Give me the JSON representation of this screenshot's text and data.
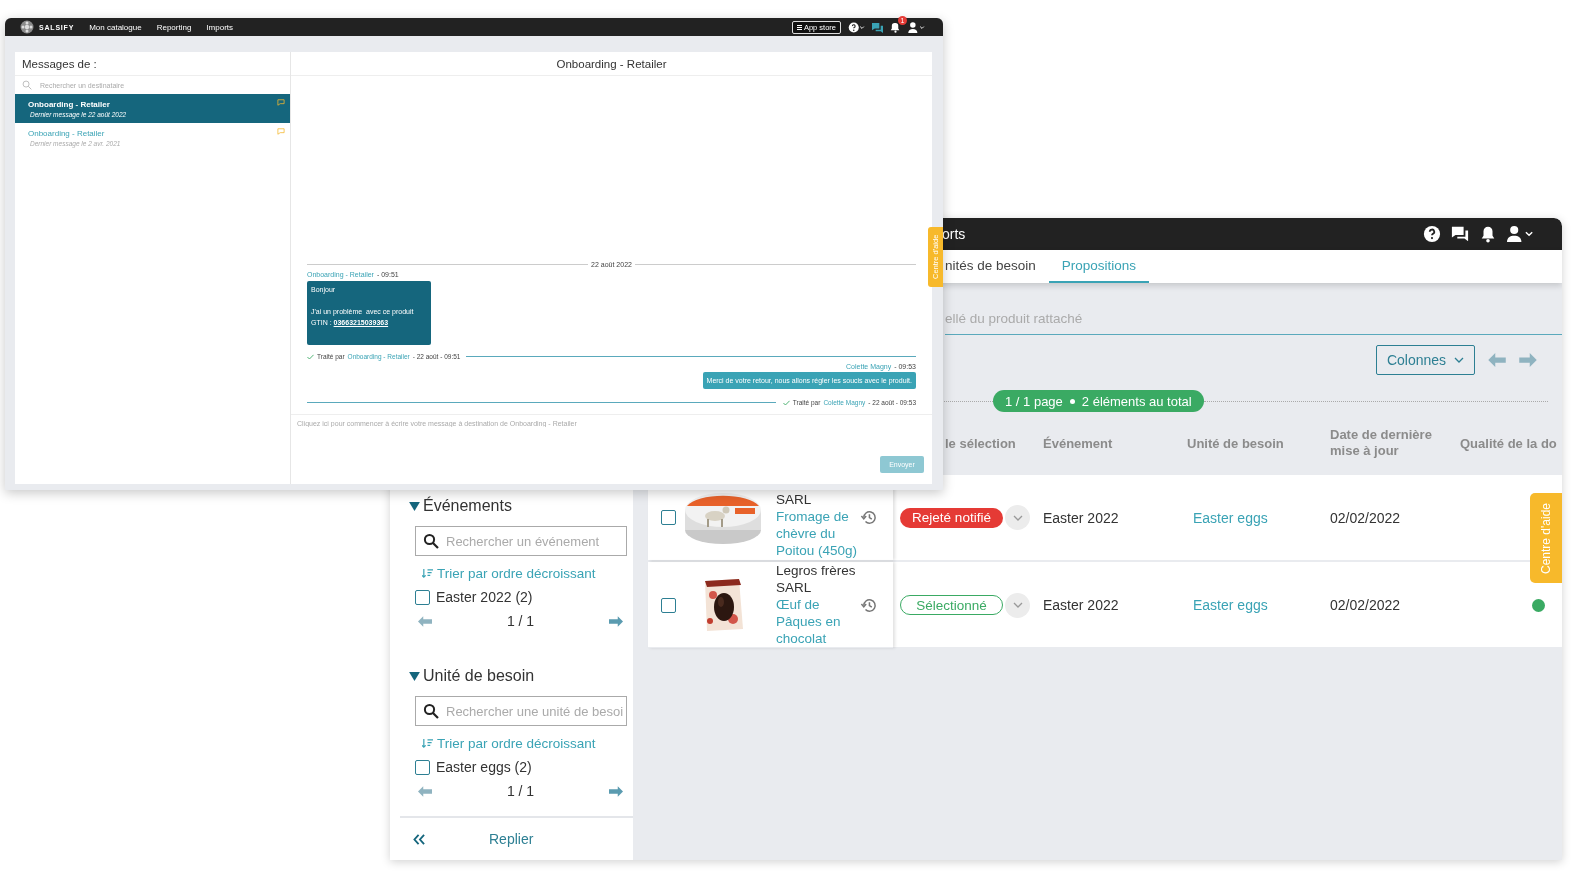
{
  "messaging_window": {
    "nav": {
      "logo": "SALSIFY",
      "items": [
        "Mon catalogue",
        "Reporting",
        "Imports"
      ],
      "app_store": "App store",
      "notification_count": "1"
    },
    "title": "Messages de :",
    "search": {
      "placeholder": "Rechercher un destinataire"
    },
    "conversations": [
      {
        "name": "Onboarding - Retailer",
        "last_message": "Dernier message le 22 août 2022",
        "selected": true
      },
      {
        "name": "Onboarding - Retailer",
        "last_message": "Dernier message le 2 avr. 2021",
        "selected": false
      }
    ],
    "thread_title": "Onboarding - Retailer",
    "date_separator": "22 août 2022",
    "messages": [
      {
        "kind": "incoming",
        "sender": "Onboarding - Retailer",
        "time": "- 09:51",
        "paragraphs": [
          "Bonjour",
          "J'ai un problème  avec ce produit"
        ],
        "gtin_label": "GTIN :",
        "gtin": "03663215039363",
        "processed": {
          "label": "Traité par",
          "by": "Onboarding - Retailer",
          "when": "- 22 août - 09:51"
        }
      },
      {
        "kind": "outgoing",
        "sender": "Colette Magny",
        "time": "- 09:53",
        "paragraphs": [
          "Merci de votre retour, nous allons régler les soucis avec le produit."
        ],
        "processed": {
          "label": "Traité par",
          "by": "Colette Magny",
          "when": "- 22 août - 09:53"
        }
      }
    ],
    "composer": {
      "placeholder": "Cliquez ici pour commencer à écrire votre message à destination de Onboarding - Retailer"
    },
    "send_button": "Envoyer",
    "help_tab": "Centre d'aide"
  },
  "catalog_window": {
    "nav_title": "orts",
    "tabs": [
      {
        "label": "nités de besoin",
        "selected": false
      },
      {
        "label": "Propositions",
        "selected": true
      }
    ],
    "search": {
      "placeholder": "ellé du produit rattaché"
    },
    "columns_button": "Colonnes",
    "pagination": {
      "page": "1 / 1 page",
      "total": "2 éléments au total"
    },
    "columns": [
      "le sélection",
      "Événement",
      "Unité de besoin",
      "Date de dernière mise à jour",
      "Qualité de la do"
    ],
    "rows": [
      {
        "checked": false,
        "supplier": "SARL",
        "product": "Fromage de chèvre du Poitou (450g)",
        "status": "Rejeté notifié",
        "kind": "rejected",
        "event": "Easter 2022",
        "unit": "Easter eggs",
        "date": "02/02/2022"
      },
      {
        "checked": false,
        "supplier": "Legros frères SARL",
        "product": "Œuf de Pâques en chocolat",
        "status": "Sélectionné",
        "kind": "selected",
        "event": "Easter 2022",
        "unit": "Easter eggs",
        "date": "02/02/2022",
        "color": "#3aaa63"
      }
    ],
    "filters": [
      {
        "title": "Événements",
        "expanded": true,
        "search_placeholder": "Rechercher un événement",
        "sort_label": "Trier par ordre décroissant",
        "options": [
          {
            "label": "Easter 2022 (2)",
            "checked": false
          }
        ],
        "pager": "1 / 1"
      },
      {
        "title": "Unité de besoin",
        "expanded": true,
        "search_placeholder": "Rechercher une unité de besoi",
        "sort_label": "Trier par ordre décroissant",
        "options": [
          {
            "label": "Easter eggs (2)",
            "checked": false
          }
        ],
        "pager": "1 / 1"
      }
    ],
    "collapse_label": "Replier",
    "help_tab": "Centre d'aide"
  }
}
